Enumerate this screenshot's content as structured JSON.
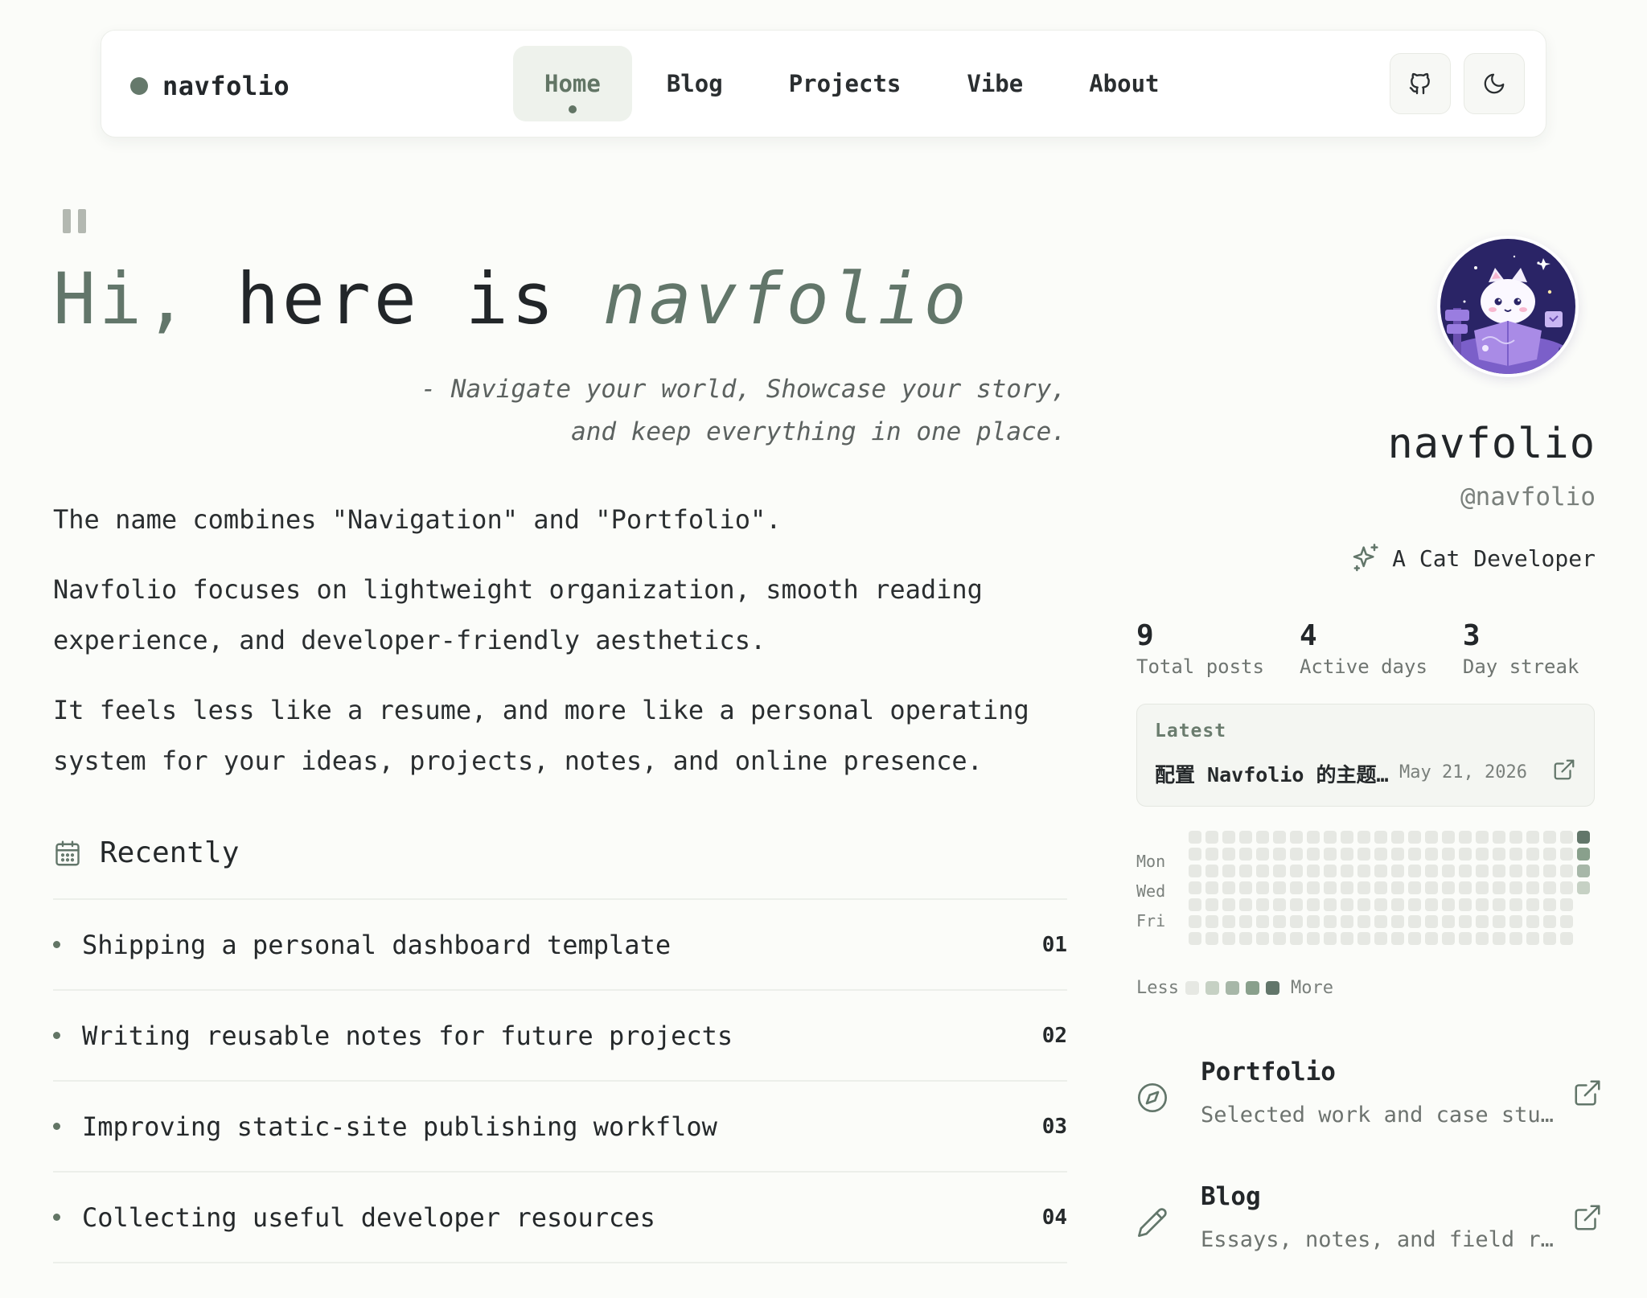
{
  "brand": {
    "name": "navfolio"
  },
  "nav": {
    "links": [
      {
        "label": "Home",
        "active": true
      },
      {
        "label": "Blog"
      },
      {
        "label": "Projects"
      },
      {
        "label": "Vibe"
      },
      {
        "label": "About"
      }
    ],
    "icons": [
      "github-icon",
      "moon-icon"
    ]
  },
  "hero": {
    "title_hi": "Hi,",
    "title_mid": "here is",
    "title_name": "navfolio",
    "tagline_line1": "- Navigate your world, Showcase your story,",
    "tagline_line2": "and keep everything in one place.",
    "paragraphs": [
      "The name combines \"Navigation\" and \"Portfolio\".",
      "Navfolio focuses on lightweight organization, smooth reading experience, and developer-friendly aesthetics.",
      "It feels less like a resume, and more like a personal operating system for your ideas, projects, notes, and online presence."
    ]
  },
  "recently": {
    "title": "Recently",
    "items": [
      {
        "text": "Shipping a personal dashboard template",
        "num": "01"
      },
      {
        "text": "Writing reusable notes for future projects",
        "num": "02"
      },
      {
        "text": "Improving static-site publishing workflow",
        "num": "03"
      },
      {
        "text": "Collecting useful developer resources",
        "num": "04"
      }
    ]
  },
  "profile": {
    "name": "navfolio",
    "handle": "@navfolio",
    "role": "A Cat Developer"
  },
  "stats": [
    {
      "value": "9",
      "label": "Total posts"
    },
    {
      "value": "4",
      "label": "Active days"
    },
    {
      "value": "3",
      "label": "Day streak"
    }
  ],
  "latest": {
    "label": "Latest",
    "title": "配置 Navfolio 的主题与内容",
    "date": "May 21, 2026"
  },
  "heatmap": {
    "days": [
      "Mon",
      "Wed",
      "Fri"
    ],
    "legend_less": "Less",
    "legend_more": "More"
  },
  "links": [
    {
      "title": "Portfolio",
      "desc": "Selected work and case studies",
      "icon": "compass-icon"
    },
    {
      "title": "Blog",
      "desc": "Essays, notes, and field reports",
      "icon": "pencil-icon"
    }
  ],
  "colors": {
    "accent": "#62766a",
    "background": "#fbfcf9"
  }
}
